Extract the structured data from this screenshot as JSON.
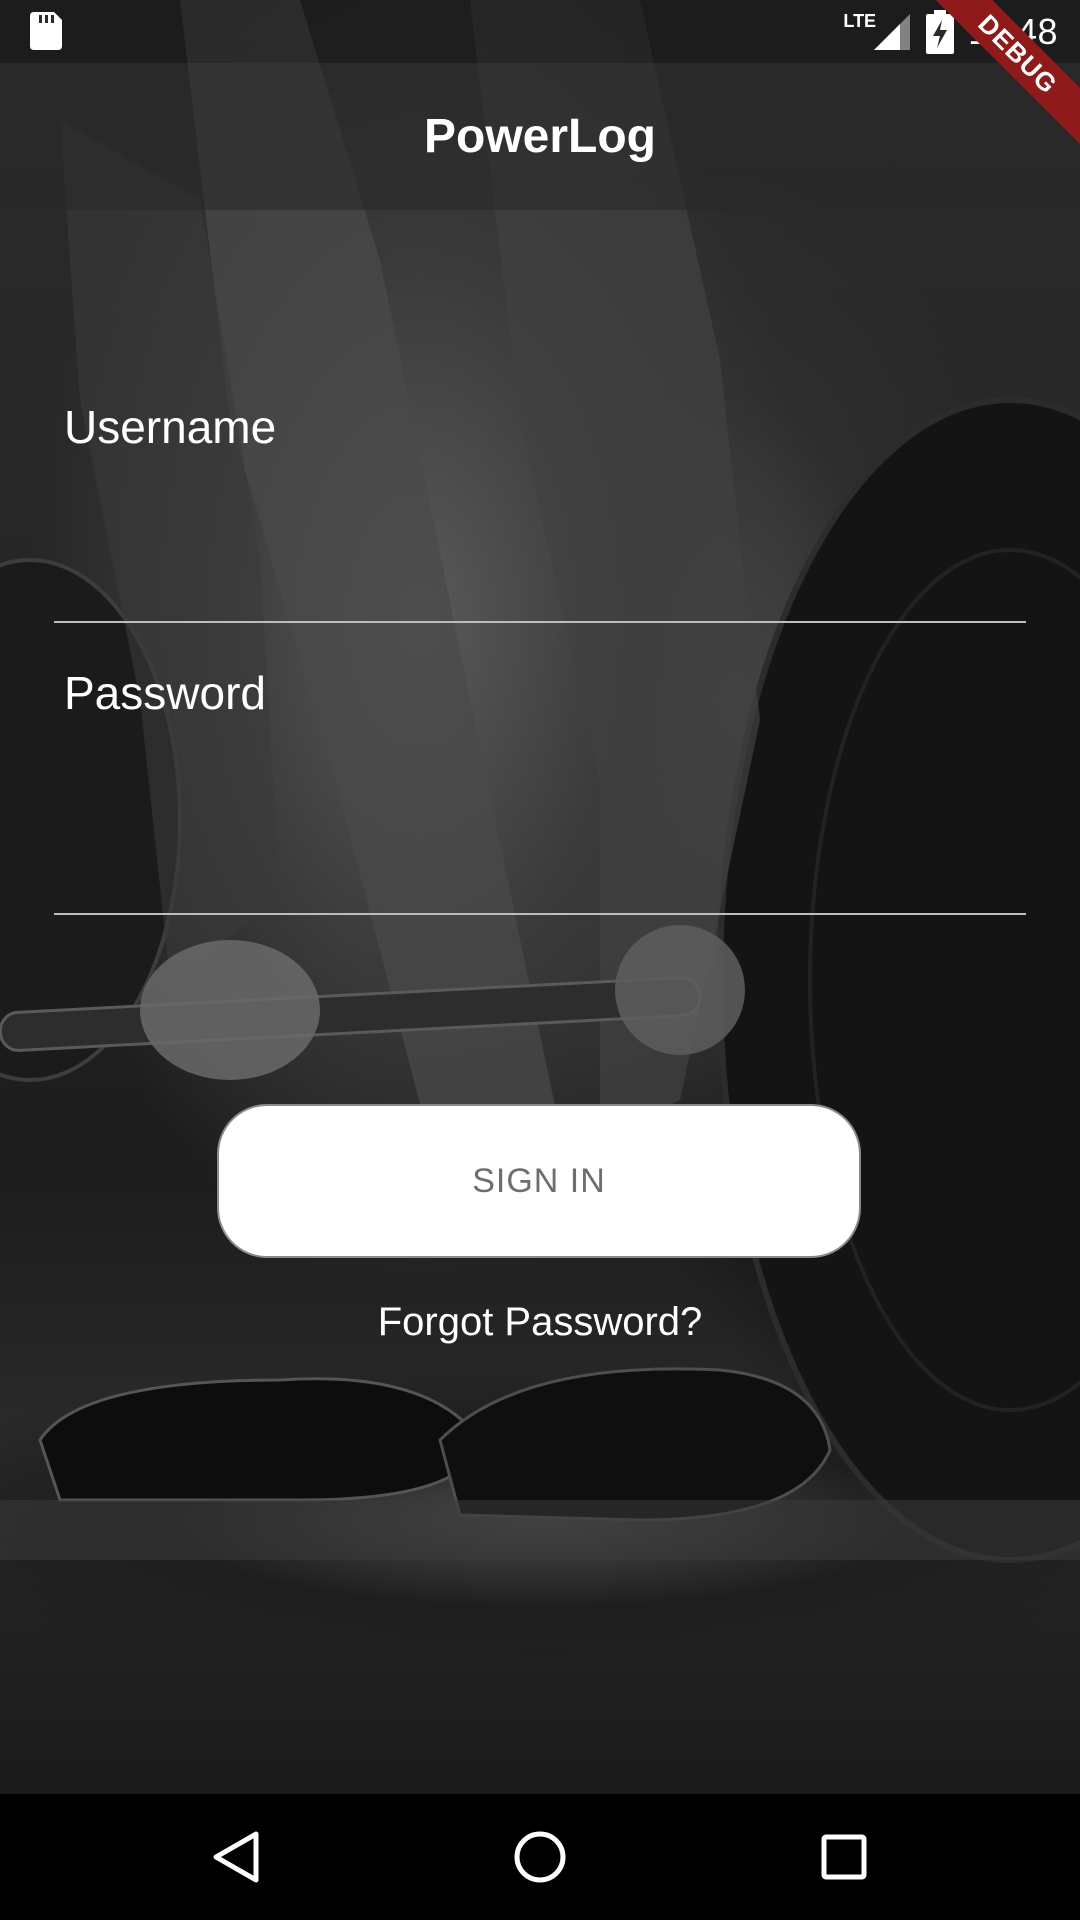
{
  "status_bar": {
    "network_label": "LTE",
    "time": "11:48",
    "icons": [
      "sd-card-icon",
      "signal-icon",
      "battery-charging-icon"
    ]
  },
  "debug_banner": {
    "label": "DEBUG",
    "color": "#8f1a1a"
  },
  "app_bar": {
    "title": "PowerLog"
  },
  "login_form": {
    "username": {
      "label": "Username",
      "value": ""
    },
    "password": {
      "label": "Password",
      "value": ""
    },
    "sign_in_label": "SIGN IN",
    "forgot_password_label": "Forgot Password?"
  },
  "navigation_bar": {
    "buttons": [
      "back-icon",
      "home-icon",
      "recents-icon"
    ]
  }
}
